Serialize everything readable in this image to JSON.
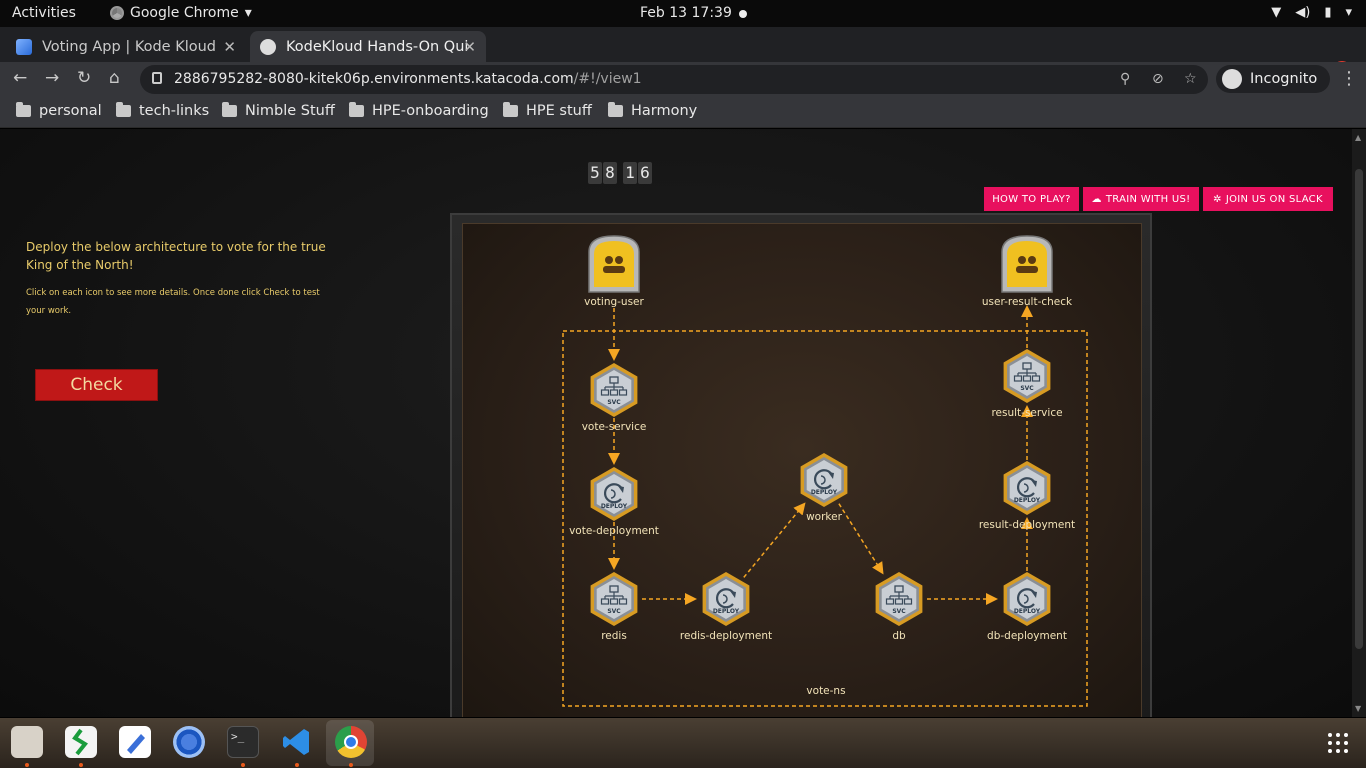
{
  "topbar": {
    "activities": "Activities",
    "app_name": "Google Chrome",
    "clock": "Feb 13  17:39"
  },
  "tabs": [
    {
      "title": "Voting App | Kode Kloud",
      "active": false
    },
    {
      "title": "KodeKloud Hands-On Qui",
      "active": true
    }
  ],
  "address_bar": {
    "host": "2886795282-8080-kitek06p.environments.katacoda.com",
    "path": "/#!/view1"
  },
  "profile": {
    "label": "Incognito"
  },
  "bookmarks": [
    "personal",
    "tech-links",
    "Nimble Stuff",
    "HPE-onboarding",
    "HPE stuff",
    "Harmony"
  ],
  "game": {
    "timer_digits": [
      "5",
      "8",
      "1",
      "6"
    ],
    "buttons": {
      "how_to_play": "HOW TO PLAY?",
      "train": "TRAIN WITH US!",
      "slack": "JOIN US ON SLACK"
    },
    "instructions": {
      "main": "Deploy the below architecture to vote for the true King of the North!",
      "sub": "Click on each icon to see more details. Once done click Check to test your work."
    },
    "check_label": "Check",
    "namespace_label": "vote-ns",
    "nodes": [
      {
        "id": "voting-user",
        "label": "voting-user",
        "kind": "user"
      },
      {
        "id": "user-result-check",
        "label": "user-result-check",
        "kind": "user"
      },
      {
        "id": "vote-service",
        "label": "vote-service",
        "kind": "svc",
        "badge": "SVC"
      },
      {
        "id": "result-service",
        "label": "result-service",
        "kind": "svc",
        "badge": "SVC"
      },
      {
        "id": "vote-deployment",
        "label": "vote-deployment",
        "kind": "deploy",
        "badge": "DEPLOY"
      },
      {
        "id": "worker",
        "label": "worker",
        "kind": "deploy",
        "badge": "DEPLOY"
      },
      {
        "id": "result-deployment",
        "label": "result-deployment",
        "kind": "deploy",
        "badge": "DEPLOY"
      },
      {
        "id": "redis",
        "label": "redis",
        "kind": "svc",
        "badge": "SVC"
      },
      {
        "id": "redis-deployment",
        "label": "redis-deployment",
        "kind": "deploy",
        "badge": "DEPLOY"
      },
      {
        "id": "db",
        "label": "db",
        "kind": "svc",
        "badge": "SVC"
      },
      {
        "id": "db-deployment",
        "label": "db-deployment",
        "kind": "deploy",
        "badge": "DEPLOY"
      }
    ],
    "edges": [
      [
        "voting-user",
        "vote-service"
      ],
      [
        "vote-service",
        "vote-deployment"
      ],
      [
        "vote-deployment",
        "redis"
      ],
      [
        "redis",
        "redis-deployment"
      ],
      [
        "redis-deployment",
        "worker"
      ],
      [
        "worker",
        "db"
      ],
      [
        "db",
        "db-deployment"
      ],
      [
        "db-deployment",
        "result-deployment"
      ],
      [
        "result-deployment",
        "result-service"
      ],
      [
        "result-service",
        "user-result-check"
      ]
    ],
    "colors": {
      "accent": "#e8105e",
      "check": "#c01818",
      "arrow": "#f5a623",
      "hex_border": "#d79b23"
    }
  },
  "dock": {
    "apps": [
      "files-icon",
      "libreoffice-icon",
      "text-editor-icon",
      "chromium-icon",
      "terminal-icon",
      "vscode-icon",
      "chrome-icon"
    ]
  }
}
